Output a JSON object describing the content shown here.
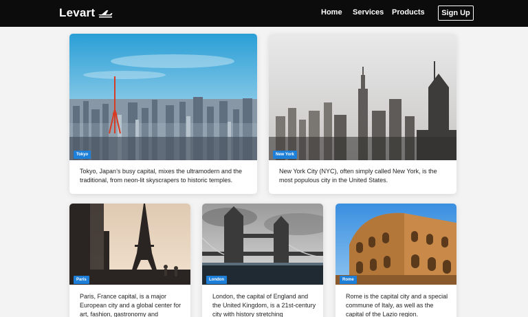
{
  "brand": {
    "name": "Levart",
    "icon": "airplane-icon"
  },
  "nav": {
    "links": [
      "Home",
      "Services",
      "Products"
    ],
    "signup_label": "Sign Up"
  },
  "cards": [
    {
      "tag": "Tokyo",
      "description": "Tokyo, Japan’s busy capital, mixes the ultramodern and the traditional, from neon-lit skyscrapers to historic temples."
    },
    {
      "tag": "New York",
      "description": "New York City (NYC), often simply called New York, is the most populous city in the United States."
    },
    {
      "tag": "Paris",
      "description": "Paris, France capital, is a major European city and a global center for art, fashion, gastronomy and"
    },
    {
      "tag": "London",
      "description": "London, the capital of England and the United Kingdom, is a 21st-century city with history stretching"
    },
    {
      "tag": "Rome",
      "description": "Rome is the capital city and a special commune of Italy, as well as the capital of the Lazio region."
    }
  ],
  "colors": {
    "navbar": "#0c0c0c",
    "tag": "#1e7fd9",
    "page_bg": "#f3f3f3"
  }
}
